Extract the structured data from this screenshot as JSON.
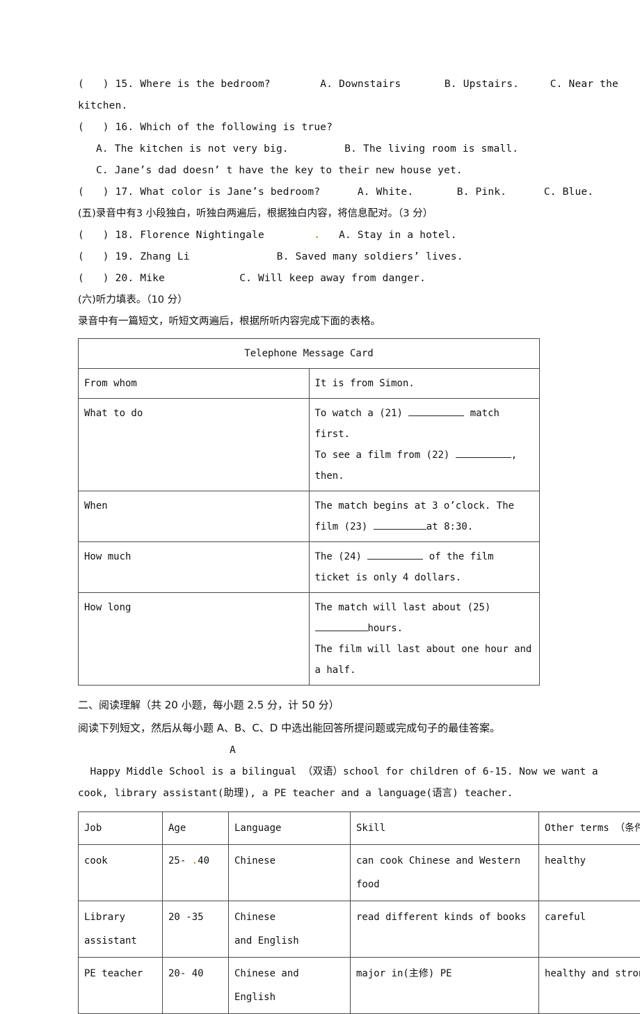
{
  "listening": {
    "q15": {
      "marker": "(   ) 15.",
      "stem": "Where is the bedroom?",
      "optA": "A. Downstairs",
      "optB": "B. Upstairs.",
      "optC": "C. Near the",
      "wrap": "kitchen."
    },
    "q16": {
      "marker": "(   ) 16.",
      "stem": "Which of the following is true?",
      "optA": "A. The kitchen is not very big.",
      "optB": "B. The living room is small.",
      "optC": "C. Jane’s dad doesn’ t have the key to their new house yet."
    },
    "q17": {
      "marker": "(   ) 17.",
      "stem": "What color is Jane’s bedroom?",
      "optA": "A. White.",
      "optB": "B. Pink.",
      "optC": "C. Blue."
    },
    "section5_heading": "(五)录音中有3 小段独白，听独白两遍后，根据独白内容，将信息配对。（3 分）",
    "match_items": [
      {
        "marker": "(   ) 18.",
        "left": "Florence Nightingale",
        "dot": ".",
        "right": "A. Stay in a hotel."
      },
      {
        "marker": "(   ) 19.",
        "left": "Zhang Li",
        "dot": "",
        "right": "B. Saved many soldiers’ lives."
      },
      {
        "marker": "(   ) 20.",
        "left": "Mike",
        "dot": "",
        "right": "C. Will keep away from danger."
      }
    ],
    "section6_heading": "(六)听力填表。（10 分）",
    "section6_instruction": "录音中有一篇短文，听短文两遍后，根据所听内容完成下面的表格。"
  },
  "message_card": {
    "title": "Telephone Message Card",
    "rows": [
      {
        "label": "From whom",
        "lines": [
          {
            "pre": "It is from Simon.",
            "blank": "",
            "post": ""
          }
        ]
      },
      {
        "label": "What to do",
        "lines": [
          {
            "pre": "To watch a  (21) ",
            "blank": "blank",
            "post": " match first."
          },
          {
            "pre": "To see a film from (22) ",
            "blank": "blank",
            "post": ", then."
          }
        ]
      },
      {
        "label": "When",
        "lines": [
          {
            "pre": "The match begins at 3 o’clock.    The film  (23) ",
            "blank": "blank",
            "post": "at 8:30."
          }
        ]
      },
      {
        "label": "How much",
        "lines": [
          {
            "pre": "The (24) ",
            "blank": "blank",
            "post": " of the film ticket is only 4 dollars."
          }
        ]
      },
      {
        "label": "How long",
        "lines": [
          {
            "pre": "The match will last about  (25) ",
            "blank": "blank",
            "post": "hours."
          },
          {
            "pre": "The film will last about one hour and a half.",
            "blank": "",
            "post": ""
          }
        ]
      }
    ]
  },
  "reading": {
    "heading": "二、阅读理解（共 20 小题，每小题 2.5 分，计 50 分）",
    "instruction": "阅读下列短文，然后从每小题 A、B、C、D 中选出能回答所提问题或完成句子的最佳答案。",
    "passage_label": "A",
    "passage_line1": "  Happy Middle School is a bilingual （双语）school for children of 6-15. Now we want a",
    "passage_line2": "cook, library assistant(助理), a PE teacher and a language(语言) teacher."
  },
  "jobs_table": {
    "headers": [
      "Job",
      "Age",
      "Language",
      "Skill",
      "Other terms （条件）"
    ],
    "rows": [
      {
        "job": "cook",
        "age_pre": "25- ",
        "age_dot": ".",
        "age_post": "40",
        "language": "Chinese",
        "skill": "can cook Chinese and Western\nfood",
        "other": "healthy"
      },
      {
        "job": "Library\nassistant",
        "age_pre": "20 -35",
        "age_dot": "",
        "age_post": "",
        "language": "Chinese\nand   English",
        "skill": "read different kinds of books",
        "other": "careful"
      },
      {
        "job": "PE teacher",
        "age_pre": "20- 40",
        "age_dot": "",
        "age_post": "",
        "language": "Chinese and\nEnglish",
        "skill": "major in(主修) PE",
        "other": "healthy and strong"
      }
    ]
  },
  "colors": {
    "text": "#111111",
    "rule": "#4a4a4a",
    "mark": "#c8a01e",
    "page": "#ffffff"
  }
}
